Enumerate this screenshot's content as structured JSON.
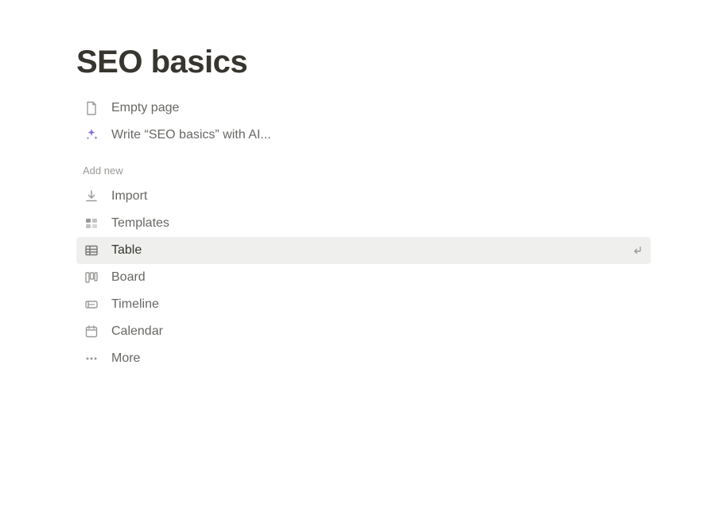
{
  "page": {
    "title": "SEO basics"
  },
  "top_options": [
    {
      "icon": "page-icon",
      "label": "Empty page"
    },
    {
      "icon": "ai-icon",
      "label": "Write “SEO basics” with AI..."
    }
  ],
  "section_header": "Add new",
  "add_new_options": [
    {
      "icon": "import-icon",
      "label": "Import",
      "highlighted": false
    },
    {
      "icon": "templates-icon",
      "label": "Templates",
      "highlighted": false
    },
    {
      "icon": "table-icon",
      "label": "Table",
      "highlighted": true
    },
    {
      "icon": "board-icon",
      "label": "Board",
      "highlighted": false
    },
    {
      "icon": "timeline-icon",
      "label": "Timeline",
      "highlighted": false
    },
    {
      "icon": "calendar-icon",
      "label": "Calendar",
      "highlighted": false
    },
    {
      "icon": "more-icon",
      "label": "More",
      "highlighted": false
    }
  ]
}
